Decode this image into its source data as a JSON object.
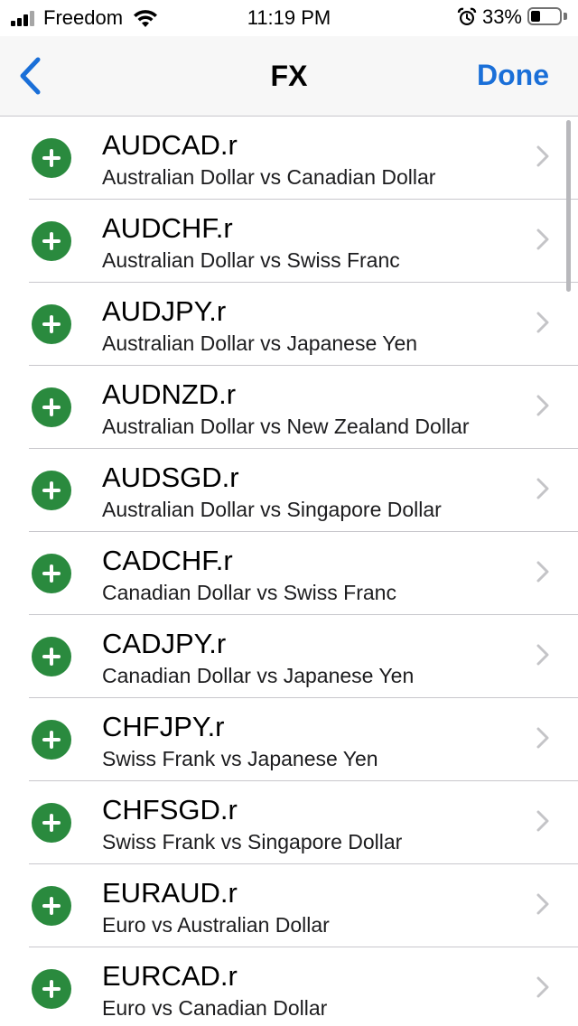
{
  "status_bar": {
    "carrier": "Freedom",
    "time": "11:19 PM",
    "battery_percent": "33%",
    "battery_level": 0.33
  },
  "nav": {
    "title": "FX",
    "done_label": "Done",
    "back_icon": "chevron-left-icon"
  },
  "colors": {
    "accent": "#1a6fd8",
    "add_green": "#2a8a3e",
    "separator": "#c8c7cc",
    "chevron": "#c4c4c7"
  },
  "instruments": [
    {
      "symbol": "AUDCAD.r",
      "description": "Australian Dollar vs Canadian Dollar"
    },
    {
      "symbol": "AUDCHF.r",
      "description": "Australian Dollar vs Swiss Franc"
    },
    {
      "symbol": "AUDJPY.r",
      "description": "Australian Dollar vs Japanese Yen"
    },
    {
      "symbol": "AUDNZD.r",
      "description": "Australian Dollar vs New Zealand Dollar"
    },
    {
      "symbol": "AUDSGD.r",
      "description": "Australian Dollar vs Singapore Dollar"
    },
    {
      "symbol": "CADCHF.r",
      "description": "Canadian Dollar vs Swiss Franc"
    },
    {
      "symbol": "CADJPY.r",
      "description": "Canadian Dollar vs Japanese Yen"
    },
    {
      "symbol": "CHFJPY.r",
      "description": "Swiss Frank vs Japanese Yen"
    },
    {
      "symbol": "CHFSGD.r",
      "description": "Swiss Frank vs Singapore Dollar"
    },
    {
      "symbol": "EURAUD.r",
      "description": "Euro vs Australian Dollar"
    },
    {
      "symbol": "EURCAD.r",
      "description": "Euro vs Canadian Dollar"
    }
  ]
}
